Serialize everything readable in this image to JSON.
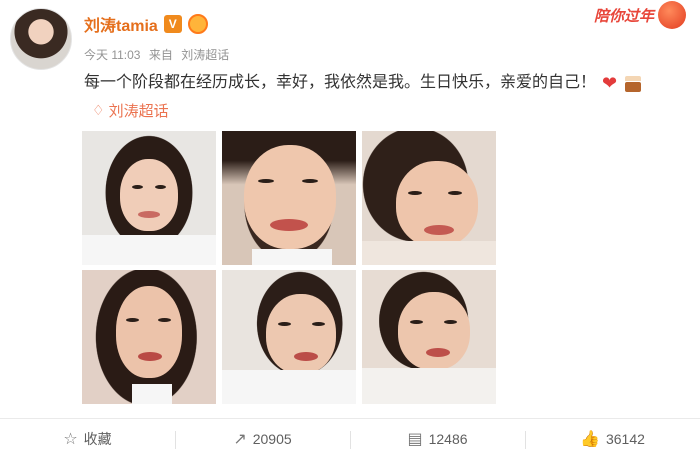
{
  "header": {
    "username": "刘涛tamia",
    "verified_badge": "V",
    "meta": {
      "time": "今天 11:03",
      "via": "来自",
      "source": "刘涛超话"
    },
    "newyear_badge": "陪你过年"
  },
  "post": {
    "text": "每一个阶段都在经历成长，幸好，我依然是我。生日快乐，亲爱的自己！",
    "emoji": [
      "heart-icon",
      "cake-icon"
    ],
    "topic": "刘涛超话"
  },
  "photos": [
    {
      "name": "photo-1"
    },
    {
      "name": "photo-2"
    },
    {
      "name": "photo-3"
    },
    {
      "name": "photo-4"
    },
    {
      "name": "photo-5"
    },
    {
      "name": "photo-6"
    }
  ],
  "actions": {
    "favorite": "收藏",
    "repost": "20905",
    "comment": "12486",
    "like": "36142"
  },
  "colors": {
    "username": "#e56f1c",
    "topic": "#eb7350",
    "newyear": "#e8463a"
  }
}
